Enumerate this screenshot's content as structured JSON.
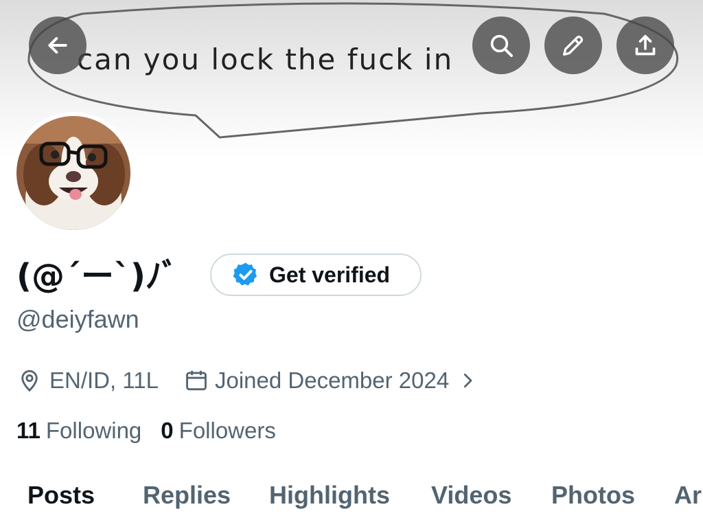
{
  "banner": {
    "text": "can you lock the fuck in"
  },
  "header_buttons": {
    "back_icon": "arrow-left-icon",
    "search_icon": "search-icon",
    "edit_icon": "pencil-icon",
    "share_icon": "share-upload-icon"
  },
  "profile": {
    "display_name": "(@´ー`)ﾉﾞ",
    "handle": "@deiyfawn",
    "verify_label": "Get verified",
    "location": "EN/ID, 11L",
    "joined": "Joined December 2024",
    "following_count": "11",
    "following_label": "Following",
    "followers_count": "0",
    "followers_label": "Followers"
  },
  "tabs": [
    {
      "label": "Posts",
      "active": true
    },
    {
      "label": "Replies",
      "active": false
    },
    {
      "label": "Highlights",
      "active": false
    },
    {
      "label": "Videos",
      "active": false
    },
    {
      "label": "Photos",
      "active": false
    },
    {
      "label": "Ar",
      "active": false
    }
  ],
  "colors": {
    "accent_blue": "#1d9bf0",
    "text_primary": "#0f1419",
    "text_secondary": "#536471"
  }
}
